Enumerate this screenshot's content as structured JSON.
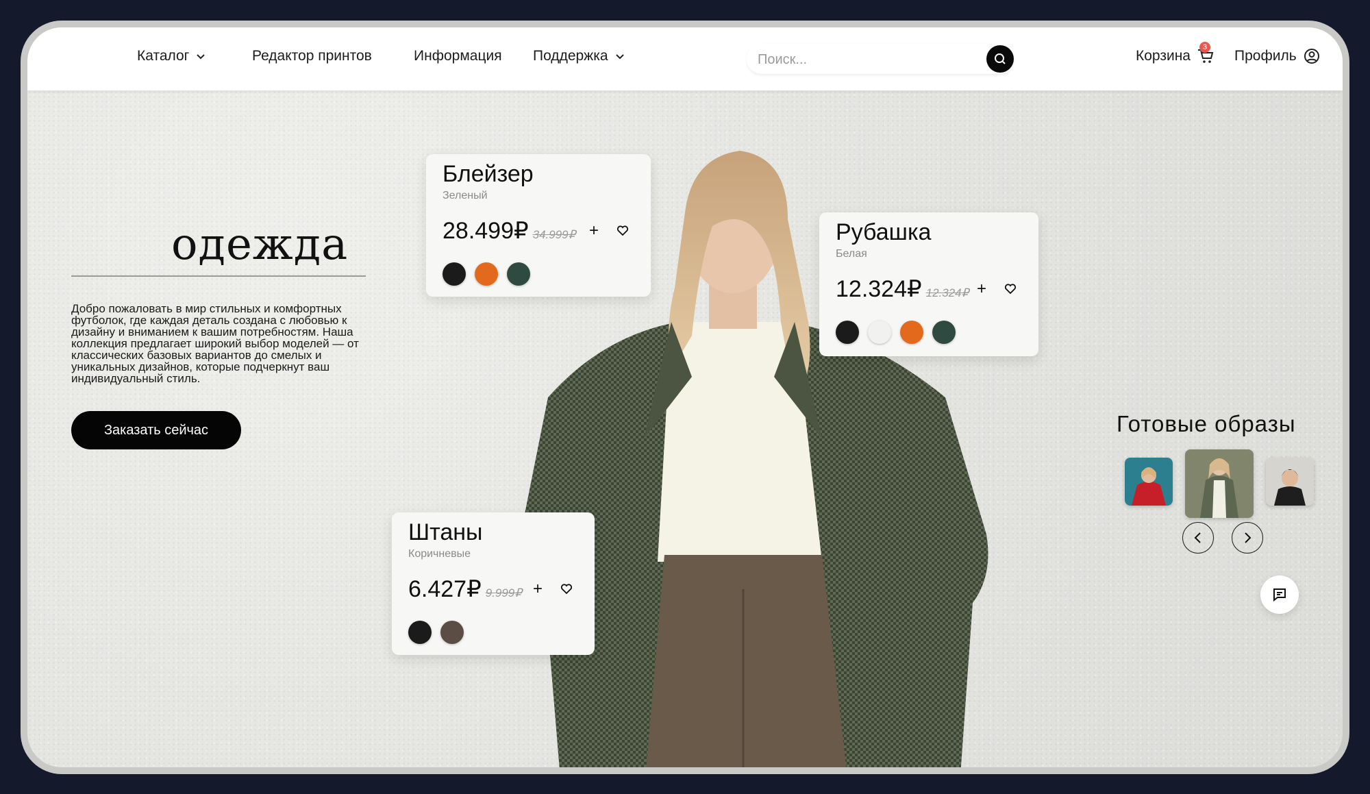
{
  "nav": {
    "catalog": "Каталог",
    "print_editor": "Редактор принтов",
    "info": "Информация",
    "support": "Поддержка"
  },
  "search": {
    "placeholder": "Поиск..."
  },
  "cart": {
    "label": "Корзина",
    "count": "3"
  },
  "profile": {
    "label": "Профиль"
  },
  "hero": {
    "title": "одежда",
    "description": "Добро пожаловать в мир стильных и комфортных футболок, где каждая деталь создана с любовью к дизайну и вниманием к вашим потребностям. Наша коллекция предлагает широкий выбор моделей — от классических базовых вариантов до смелых и уникальных дизайнов, которые подчеркнут ваш индивидуальный стиль.",
    "cta": "Заказать сейчас"
  },
  "products": [
    {
      "title": "Блейзер",
      "subtitle": "Зеленый",
      "price": "28.499₽",
      "old_price": "34.999₽",
      "plus": "+",
      "colors": [
        "#1b1b1b",
        "#e36a1c",
        "#2f4a40"
      ]
    },
    {
      "title": "Рубашка",
      "subtitle": "Белая",
      "price": "12.324₽",
      "old_price": "12.324₽",
      "plus": "+",
      "colors": [
        "#1b1b1b",
        "#f1f1ef",
        "#e36a1c",
        "#2f4a40"
      ]
    },
    {
      "title": "Штаны",
      "subtitle": "Коричневые",
      "price": "6.427₽",
      "old_price": "9.999₽",
      "plus": "+",
      "colors": [
        "#1b1b1b",
        "#5c4d44"
      ]
    }
  ],
  "looks": {
    "title": "Готовые образы"
  }
}
